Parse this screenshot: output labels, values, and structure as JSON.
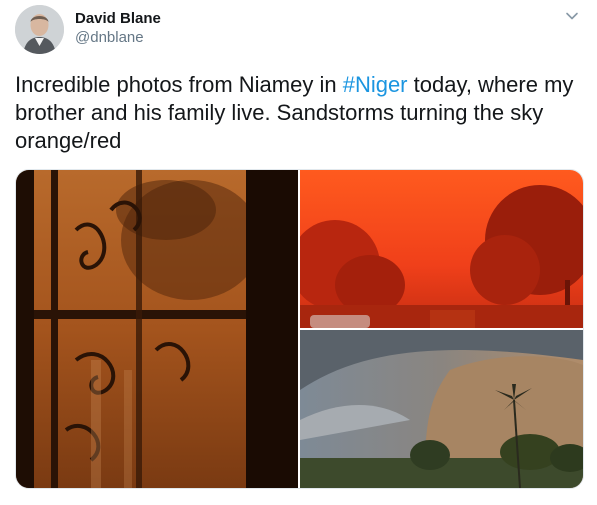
{
  "tweet": {
    "author_name": "David Blane",
    "author_handle": "@dnblane",
    "text_before": "Incredible photos from Niamey in ",
    "hashtag": "#Niger",
    "text_after": " today, where my brother and his family live. Sandstorms turning the sky orange/red"
  },
  "icons": {
    "menu": "chevron-down-icon"
  },
  "colors": {
    "hashtag": "#1b95e0",
    "handle": "#657786",
    "text": "#14171a"
  }
}
